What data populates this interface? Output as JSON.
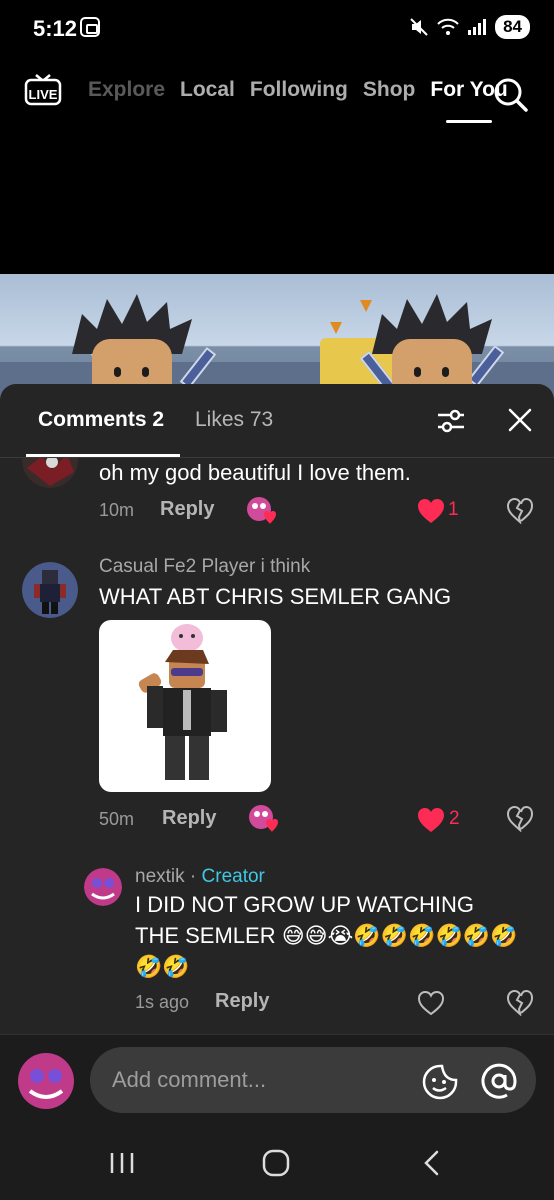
{
  "status_bar": {
    "time": "5:12",
    "battery": "84"
  },
  "top_nav": {
    "live_label": "LIVE",
    "tabs": [
      {
        "label": "Explore",
        "active": false
      },
      {
        "label": "Local",
        "active": false
      },
      {
        "label": "Following",
        "active": false
      },
      {
        "label": "Shop",
        "active": false
      },
      {
        "label": "For You",
        "active": true
      }
    ]
  },
  "comments_panel": {
    "comments_tab": "Comments 2",
    "likes_tab": "Likes 73"
  },
  "comments": [
    {
      "text": "oh my god beautiful I love them.",
      "time": "10m",
      "reply_label": "Reply",
      "like_count": "1",
      "liked": true
    },
    {
      "username": "Casual Fe2 Player i think",
      "text": "WHAT ABT CHRIS SEMLER GANG",
      "time": "50m",
      "reply_label": "Reply",
      "like_count": "2",
      "liked": true,
      "has_image": true
    },
    {
      "username": "nextik",
      "separator": " · ",
      "badge": "Creator",
      "text_line1": "I DID NOT GROW UP WATCHING",
      "text_line2": "THE SEMLER 😅😅😭🤣🤣🤣🤣🤣🤣",
      "text_line3": "🤣🤣",
      "time": "1s ago",
      "reply_label": "Reply",
      "liked": false
    }
  ],
  "input": {
    "placeholder": "Add comment..."
  },
  "colors": {
    "accent": "#fe2c55",
    "creator_badge": "#3fc7e4",
    "panel_bg": "#252525"
  }
}
